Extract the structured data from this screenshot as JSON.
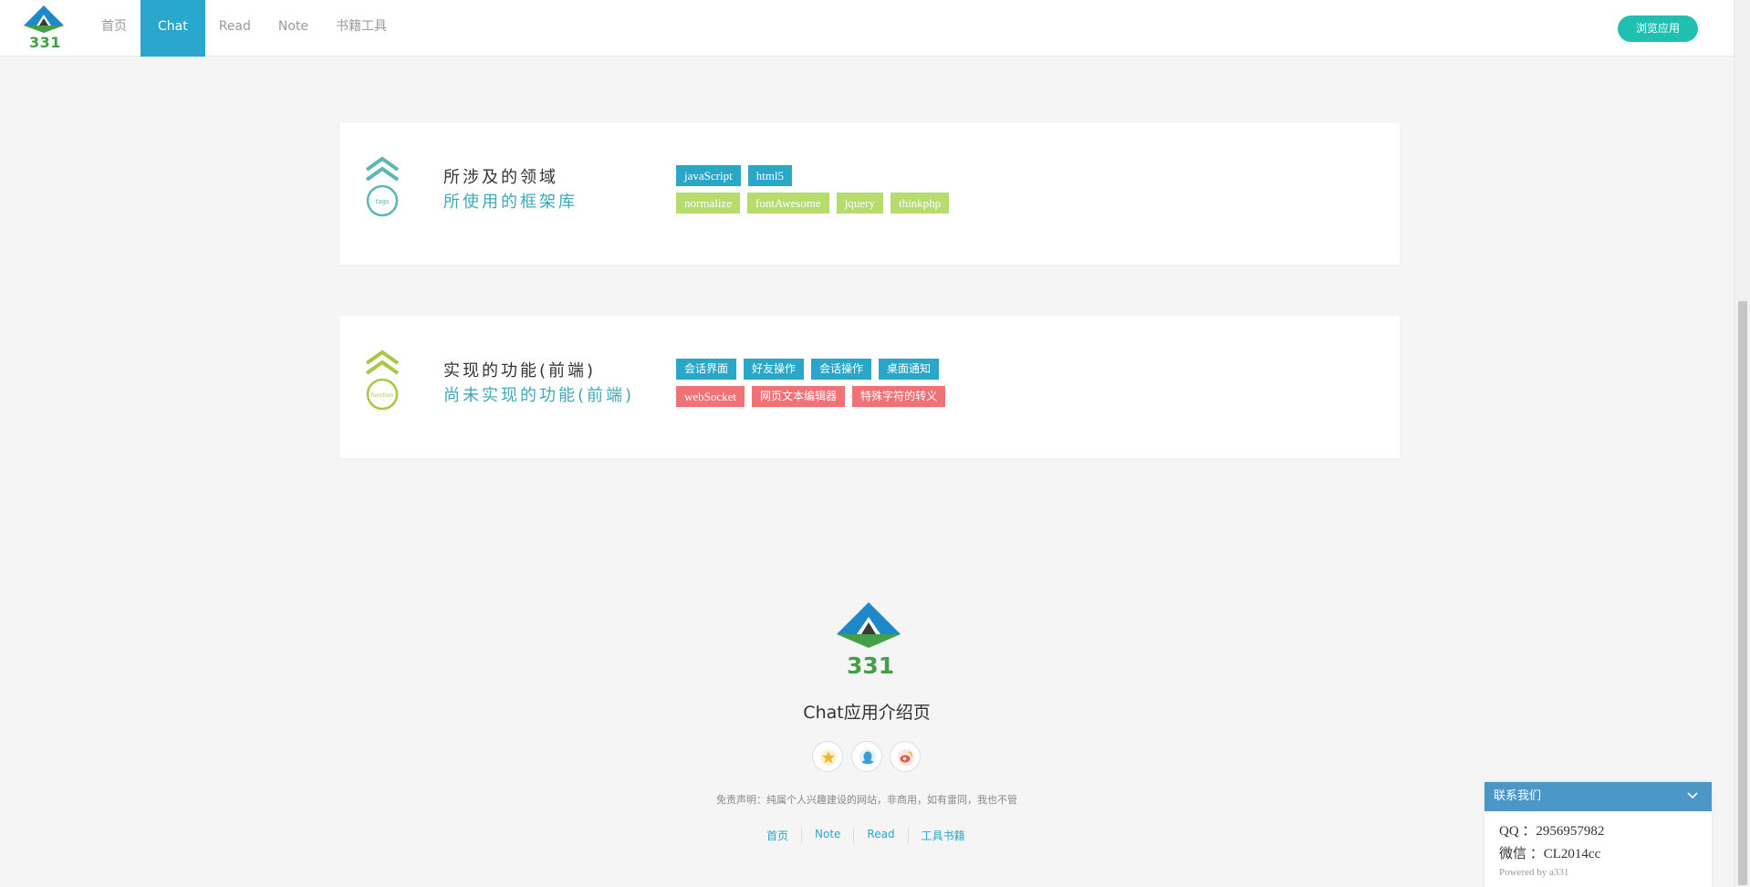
{
  "nav": {
    "logo_text": "331",
    "items": [
      {
        "label": "首页",
        "active": false
      },
      {
        "label": "Chat",
        "active": true
      },
      {
        "label": "Read",
        "active": false
      },
      {
        "label": "Note",
        "active": false
      },
      {
        "label": "书籍工具",
        "active": false
      }
    ],
    "browse_button": "浏览应用"
  },
  "card1": {
    "icon_label": "tags",
    "title": "所涉及的领域",
    "subtitle": "所使用的框架库",
    "row1": [
      "javaScript",
      "html5"
    ],
    "row2": [
      "normalize",
      "fontAwesome",
      "jquery",
      "thinkphp"
    ]
  },
  "card2": {
    "icon_label": "function",
    "title": "实现的功能(前端)",
    "subtitle": "尚未实现的功能(前端)",
    "row1": [
      "会话界面",
      "好友操作",
      "会话操作",
      "桌面通知"
    ],
    "row2": [
      "webSocket",
      "网页文本编辑器",
      "特殊字符的转义"
    ]
  },
  "footer": {
    "logo_text": "331",
    "title": "Chat应用介绍页",
    "social_icons": [
      "star-icon",
      "qq-icon",
      "weibo-icon"
    ],
    "disclaimer": "免责声明：纯属个人兴趣建设的网站，非商用，如有雷同，我也不管",
    "links": [
      "首页",
      "Note",
      "Read",
      "工具书籍"
    ]
  },
  "contact": {
    "title": "联系我们",
    "qq": "QQ ：2956957982",
    "wechat": "微信 ：CL2014cc",
    "powered": "Powered by a331"
  },
  "colors": {
    "accent": "#2aa7cc",
    "browse": "#1fc0b0",
    "tag_blue": "#2aa6c8",
    "tag_green": "#b6dc6e",
    "tag_red": "#ef7277",
    "logo_green": "#43a047"
  }
}
